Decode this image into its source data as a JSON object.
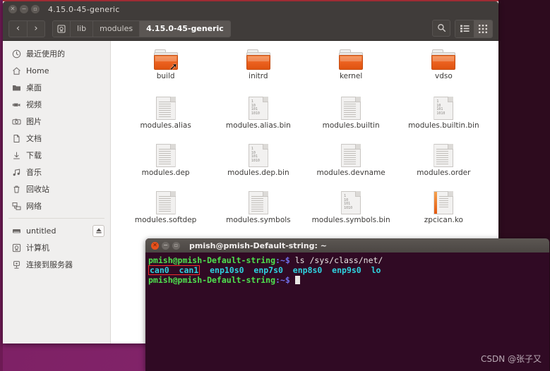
{
  "file_manager": {
    "title": "4.15.0-45-generic",
    "window_buttons": [
      "close",
      "minimize",
      "maximize"
    ],
    "nav": {
      "back": "‹",
      "forward": "›"
    },
    "breadcrumb": [
      {
        "label": "",
        "icon": "computer-icon",
        "active": false
      },
      {
        "label": "lib",
        "icon": "",
        "active": false
      },
      {
        "label": "modules",
        "icon": "",
        "active": false
      },
      {
        "label": "4.15.0-45-generic",
        "icon": "",
        "active": true
      }
    ],
    "toolbar_right": [
      {
        "name": "search-icon",
        "glyph": "search"
      },
      {
        "name": "list-view-icon",
        "glyph": "list",
        "active": false
      },
      {
        "name": "grid-view-icon",
        "glyph": "grid",
        "active": true
      }
    ],
    "sidebar": {
      "items": [
        {
          "label": "最近使用的",
          "icon": "clock-icon"
        },
        {
          "label": "Home",
          "icon": "home-icon"
        },
        {
          "label": "桌面",
          "icon": "folder-icon"
        },
        {
          "label": "视频",
          "icon": "video-icon"
        },
        {
          "label": "图片",
          "icon": "camera-icon"
        },
        {
          "label": "文档",
          "icon": "document-icon"
        },
        {
          "label": "下载",
          "icon": "download-icon"
        },
        {
          "label": "音乐",
          "icon": "music-icon"
        },
        {
          "label": "回收站",
          "icon": "trash-icon"
        },
        {
          "label": "网络",
          "icon": "network-icon"
        }
      ],
      "devices": [
        {
          "label": "untitled",
          "icon": "drive-icon",
          "eject": true
        },
        {
          "label": "计算机",
          "icon": "computer-icon",
          "eject": false
        },
        {
          "label": "连接到服务器",
          "icon": "server-icon",
          "eject": false
        }
      ]
    },
    "files": [
      {
        "name": "build",
        "type": "folder",
        "symlink": true
      },
      {
        "name": "initrd",
        "type": "folder",
        "symlink": false
      },
      {
        "name": "kernel",
        "type": "folder",
        "symlink": false
      },
      {
        "name": "vdso",
        "type": "folder",
        "symlink": false
      },
      {
        "name": "modules.alias",
        "type": "text"
      },
      {
        "name": "modules.alias.bin",
        "type": "binary"
      },
      {
        "name": "modules.builtin",
        "type": "text"
      },
      {
        "name": "modules.builtin.bin",
        "type": "binary"
      },
      {
        "name": "modules.dep",
        "type": "text"
      },
      {
        "name": "modules.dep.bin",
        "type": "binary"
      },
      {
        "name": "modules.devname",
        "type": "text"
      },
      {
        "name": "modules.order",
        "type": "text"
      },
      {
        "name": "modules.softdep",
        "type": "text"
      },
      {
        "name": "modules.symbols",
        "type": "text"
      },
      {
        "name": "modules.symbols.bin",
        "type": "binary"
      },
      {
        "name": "zpcican.ko",
        "type": "module"
      }
    ],
    "binary_icon_lines": [
      "1",
      "10",
      "101",
      "1010"
    ]
  },
  "terminal": {
    "title": "pmish@pmish-Default-string: ~",
    "window_buttons": [
      "close",
      "minimize",
      "maximize"
    ],
    "lines": [
      {
        "prompt_user": "pmish@pmish-Default-string",
        "prompt_path": ":~$",
        "command": " ls /sys/class/net/"
      },
      {
        "highlighted": "can0  can1",
        "rest": "  enp10s0  enp7s0  enp8s0  enp9s0  lo"
      },
      {
        "prompt_user": "pmish@pmish-Default-string",
        "prompt_path": ":~$",
        "command": " ",
        "cursor": true
      }
    ],
    "highlight_color": "#ee2b2b",
    "background": "#300a24"
  },
  "watermark": {
    "text": "CSDN @张子又"
  },
  "desktop": {
    "top_color": "#ad3039",
    "bottom_color": "#7d2064"
  }
}
